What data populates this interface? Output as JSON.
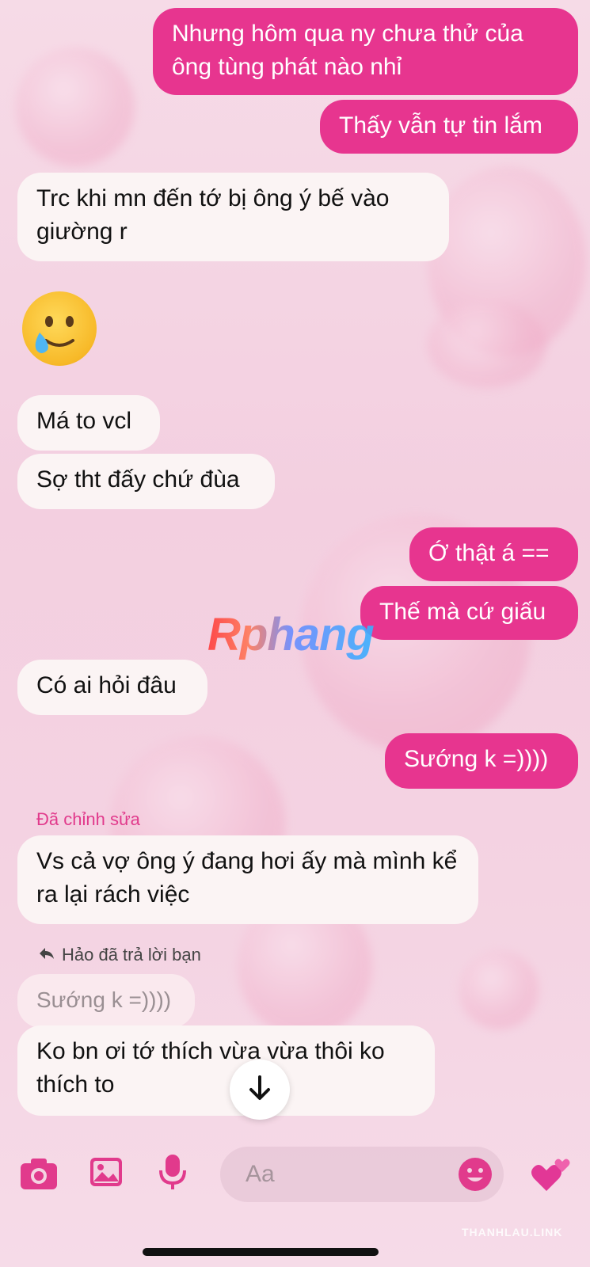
{
  "messages": [
    {
      "dir": "out",
      "text": "Nhưng hôm qua ny chưa thử của ông tùng phát nào nhỉ"
    },
    {
      "dir": "out",
      "text": "Thấy vẫn tự tin lắm"
    },
    {
      "dir": "in",
      "text": "Trc khi mn đến tớ bị ông ý bế vào giường r"
    },
    {
      "dir": "in",
      "emoji": "smiling-face-with-tear"
    },
    {
      "dir": "in",
      "text": "Má to vcl"
    },
    {
      "dir": "in",
      "text": "Sợ tht đấy chứ đùa"
    },
    {
      "dir": "out",
      "text": "Ớ thật á =="
    },
    {
      "dir": "out",
      "text": "Thế mà cứ giấu"
    },
    {
      "dir": "in",
      "text": "Có ai hỏi đâu"
    },
    {
      "dir": "out",
      "text": "Sướng k =))))"
    },
    {
      "dir": "in",
      "text": "Vs cả vợ ông ý đang hơi ấy mà mình kể ra lại rách việc"
    },
    {
      "dir": "in",
      "quoted": "Sướng k =))))"
    },
    {
      "dir": "in",
      "text": "Ko bn ơi tớ thích vừa vừa thôi ko thích to"
    }
  ],
  "edited_label": "Đã chỉnh sửa",
  "reply_note": "Hảo đã trả lời bạn",
  "watermark": "Rphang",
  "site_mark": "THANHLAU.LINK",
  "composer": {
    "placeholder": "Aa",
    "icons": [
      "camera-icon",
      "image-icon",
      "microphone-icon",
      "emoji-icon",
      "hearts-icon"
    ]
  },
  "colors": {
    "outgoing": "#e7358f",
    "incoming": "#fbf4f4",
    "accent": "#e13a8c"
  }
}
